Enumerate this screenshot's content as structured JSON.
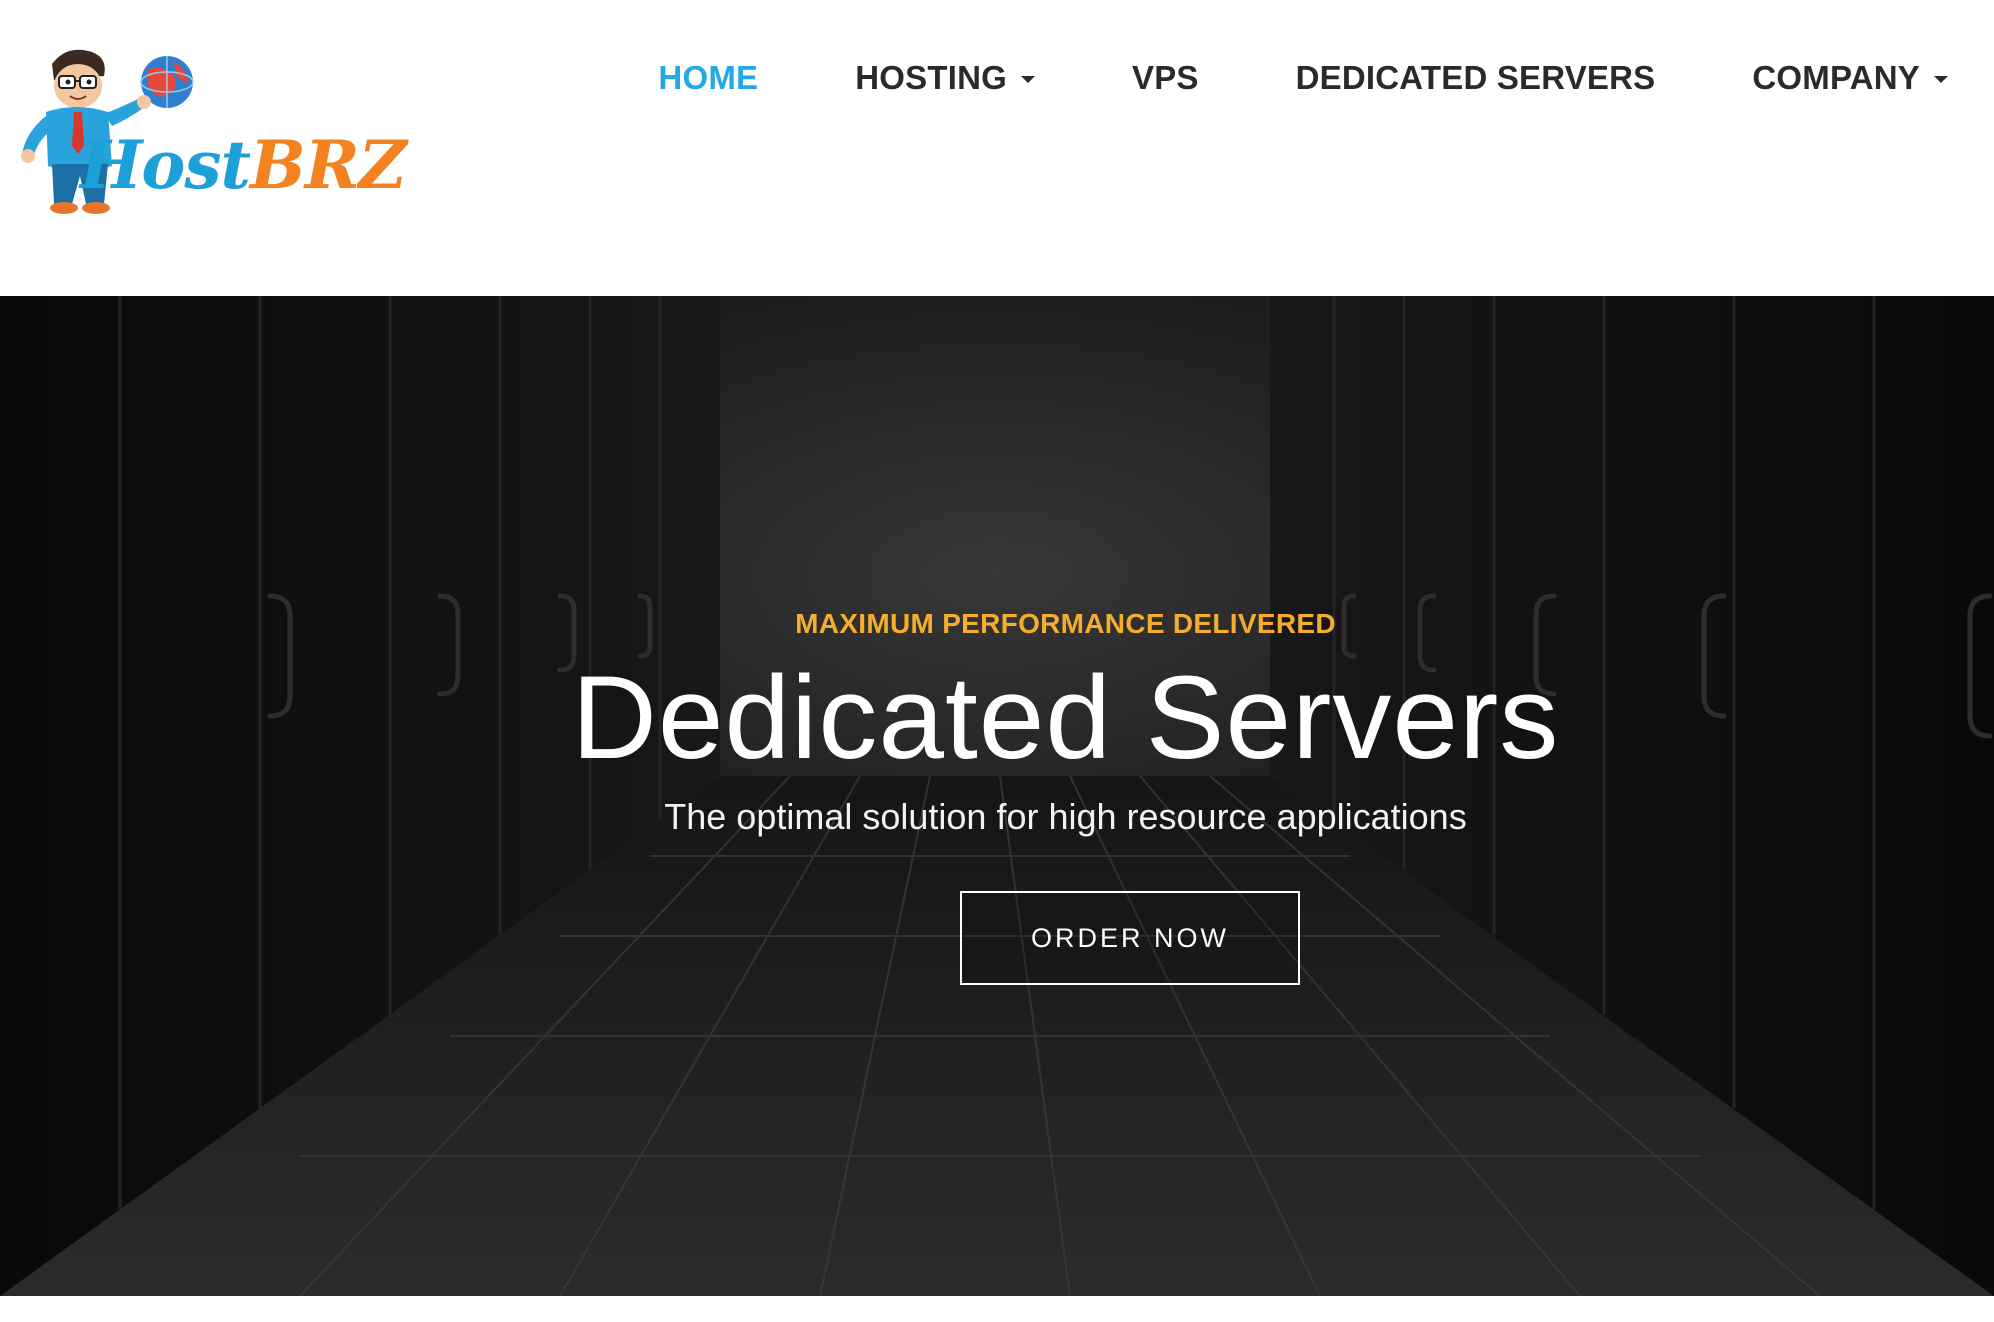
{
  "logo": {
    "brand_part1": "Host",
    "brand_part2": "BRZ"
  },
  "nav": {
    "items": [
      {
        "label": "HOME",
        "active": true,
        "dropdown": false
      },
      {
        "label": "HOSTING",
        "active": false,
        "dropdown": true
      },
      {
        "label": "VPS",
        "active": false,
        "dropdown": false
      },
      {
        "label": "DEDICATED SERVERS",
        "active": false,
        "dropdown": false
      },
      {
        "label": "COMPANY",
        "active": false,
        "dropdown": true
      }
    ]
  },
  "hero": {
    "eyebrow": "MAXIMUM PERFORMANCE DELIVERED",
    "title": "Dedicated Servers",
    "subtitle": "The optimal solution for high resource applications",
    "cta_label": "ORDER NOW"
  },
  "colors": {
    "accent_blue": "#24a9e6",
    "accent_orange": "#f6ac2c",
    "logo_blue": "#1d9fd7",
    "logo_orange": "#f58220",
    "hero_bg": "#151515"
  }
}
